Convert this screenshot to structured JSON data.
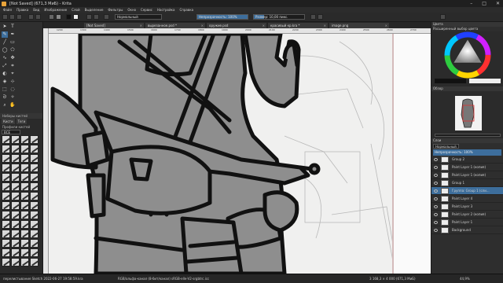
{
  "window": {
    "title": "[Not Saved] (671,3 MиБ) - Krita",
    "controls": [
      "–",
      "□",
      "✕"
    ]
  },
  "menu": [
    "Файл",
    "Правка",
    "Вид",
    "Изображение",
    "Слой",
    "Выделение",
    "Фильтры",
    "Окно",
    "Сервис",
    "Настройка",
    "Справка"
  ],
  "tool_options": {
    "blend_mode": "Нормальный",
    "opacity_label": "Непрозрачность: 100%",
    "opacity": 1.0,
    "size_label": "Размер: 10,00 пикс.",
    "size_fraction": 0.2
  },
  "doc_tabs": [
    {
      "label": "[Not Saved]"
    },
    {
      "label": "вырезанное.psd *"
    },
    {
      "label": "оружие.psd"
    },
    {
      "label": "красивый кр.kra *"
    },
    {
      "label": "image.png"
    }
  ],
  "ruler_ticks": [
    "1200",
    "1300",
    "1400",
    "1500",
    "1600",
    "1700",
    "1800",
    "1900",
    "2000",
    "2100",
    "2200",
    "2300",
    "2400",
    "2500",
    "2600",
    "2700"
  ],
  "brush_panel": {
    "title": "Наборы кистей",
    "tabs": [
      "Кисти",
      "Теги"
    ],
    "filter_label": "Профили кистей",
    "tag_select": "ВСЕ"
  },
  "dock": {
    "color_header": "Цвета",
    "color_sub": "Расширенный выбор цвета",
    "overview_header": "Обзор",
    "layers_header": "Слои",
    "layers_mode": "Нормальный",
    "layers_opacity": "Непрозрачность: 100%"
  },
  "layers": [
    {
      "name": "Group 2",
      "selected": false,
      "group": true
    },
    {
      "name": "Paint Layer 1 (копия)",
      "selected": false,
      "group": false
    },
    {
      "name": "Paint Layer 1 (копия)",
      "selected": false,
      "group": false
    },
    {
      "name": "Group 1",
      "selected": false,
      "group": true
    },
    {
      "name": "Группа: Group 1 (сли...",
      "selected": true,
      "group": false
    },
    {
      "name": "Paint Layer 4",
      "selected": false,
      "group": false
    },
    {
      "name": "Paint Layer 3",
      "selected": false,
      "group": false
    },
    {
      "name": "Paint Layer 2 (копия)",
      "selected": false,
      "group": false
    },
    {
      "name": "Paint Layer 1",
      "selected": false,
      "group": false
    },
    {
      "name": "Background",
      "selected": false,
      "group": false
    }
  ],
  "status": {
    "left": "перелистывание Sketch 2022-06-27 19:58:59.kra",
    "mid": "RGB/альфа-канал (8-бит/канал) sRGB-elle-V2-srgbtrc.icc",
    "right": "3 168,3 × 4 000 (671,3 MиБ)",
    "zoom": "44,9%"
  },
  "colors": {
    "accent": "#3d6e9c",
    "ink": "#111111",
    "body_fill": "#8e8e8e"
  }
}
